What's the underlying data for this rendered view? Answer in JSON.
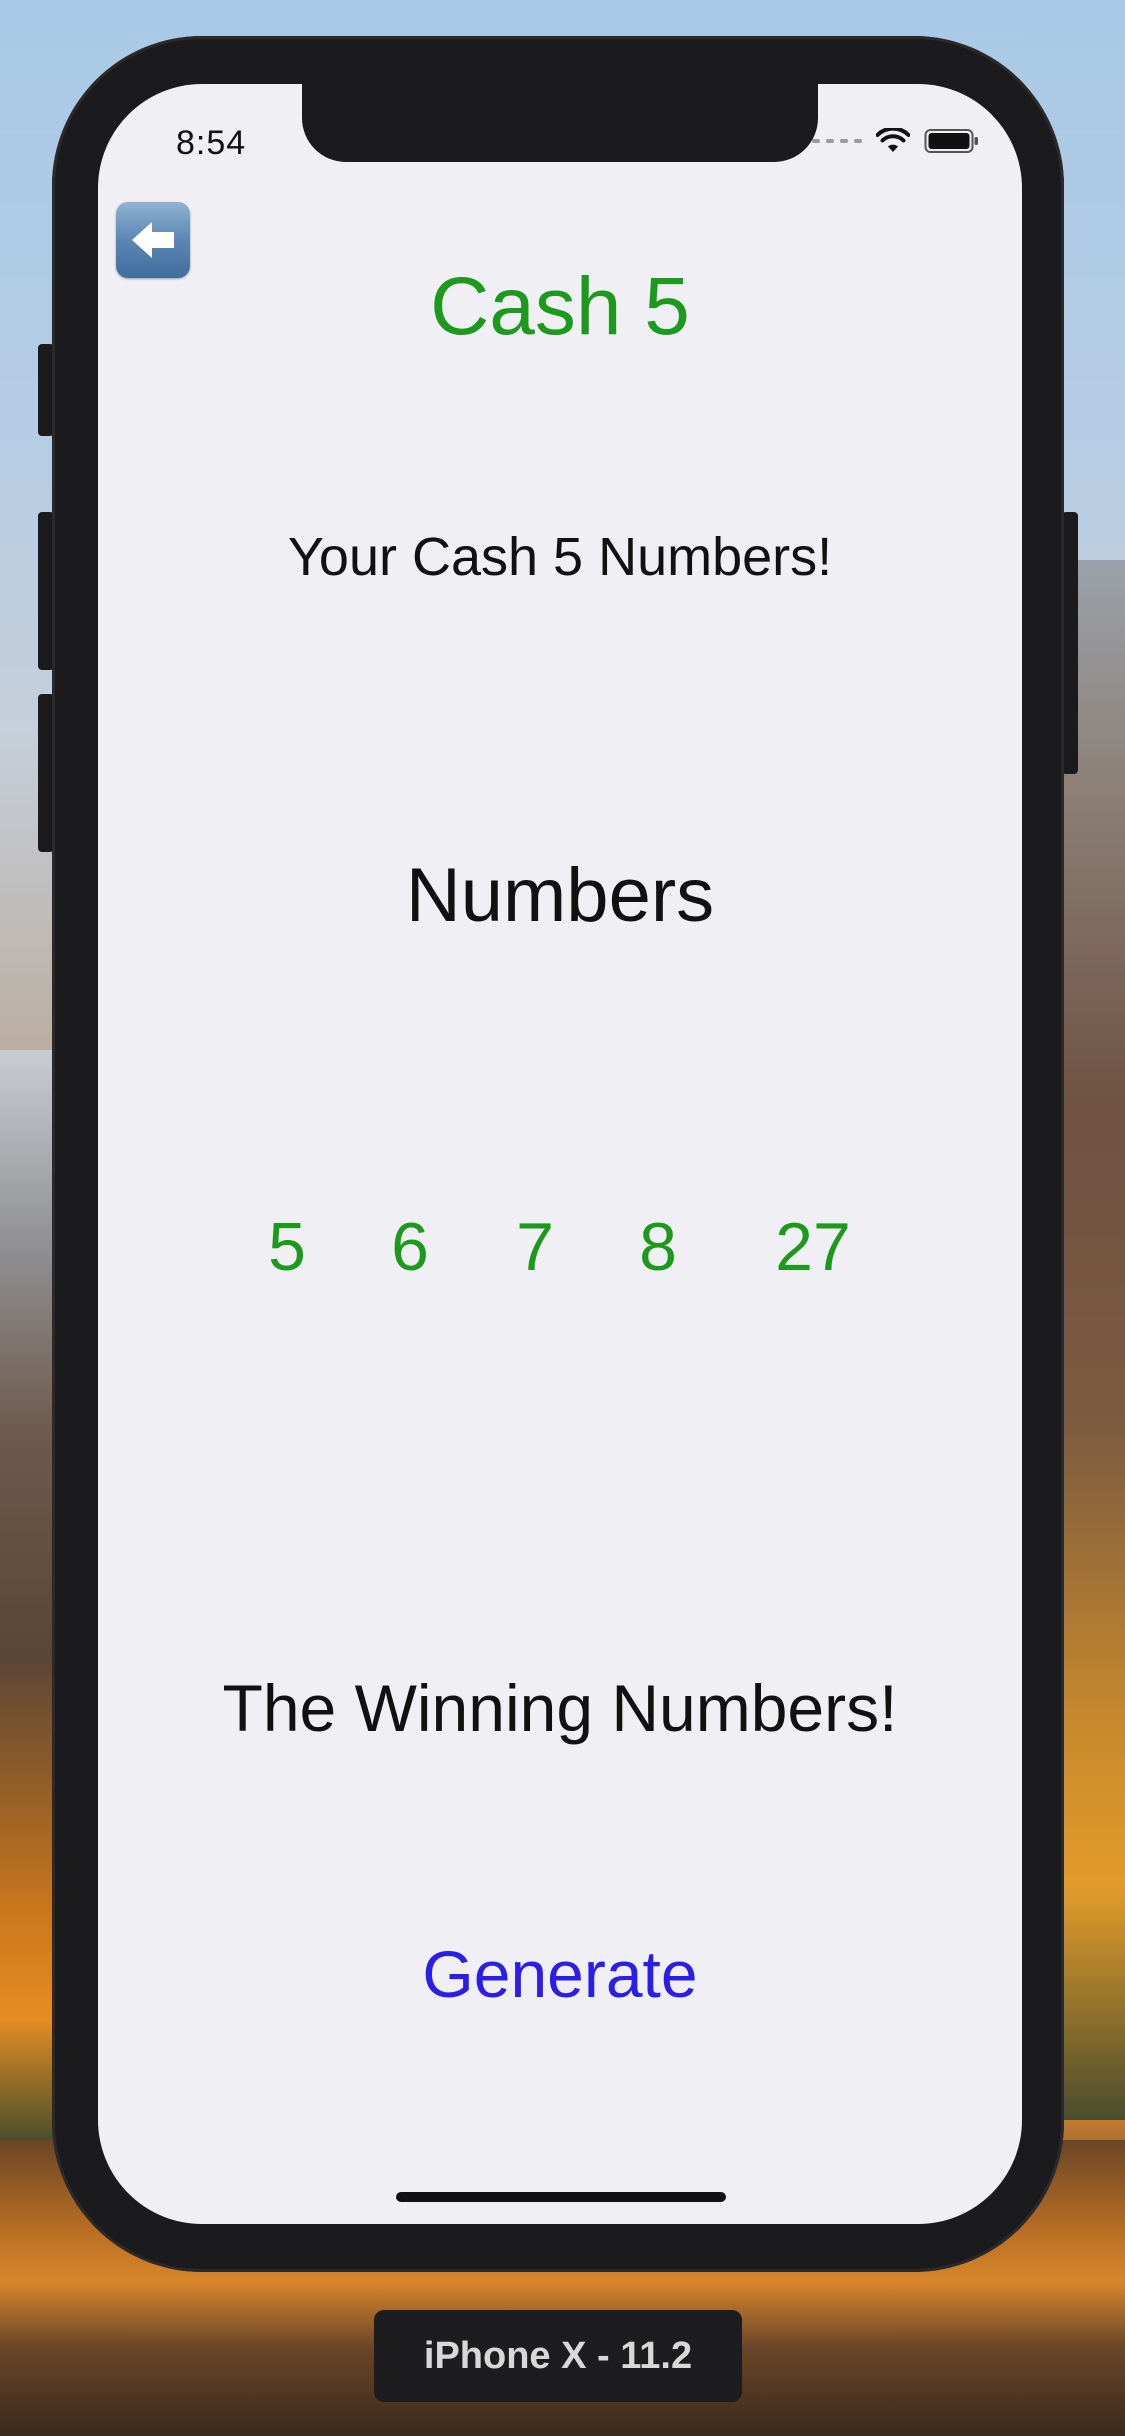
{
  "status_bar": {
    "time": "8:54"
  },
  "nav": {
    "back_icon": "left-arrow-icon"
  },
  "app": {
    "title": "Cash 5",
    "subtitle": "Your Cash 5 Numbers!",
    "numbers_label": "Numbers",
    "numbers": [
      "5",
      "6",
      "7",
      "8",
      "27"
    ],
    "winning_label": "The Winning Numbers!",
    "generate_label": "Generate"
  },
  "simulator": {
    "device_label": "iPhone X - 11.2"
  },
  "colors": {
    "accent_green": "#1d9a1d",
    "button_blue": "#2a1ee8",
    "screen_bg": "#efeff4"
  }
}
